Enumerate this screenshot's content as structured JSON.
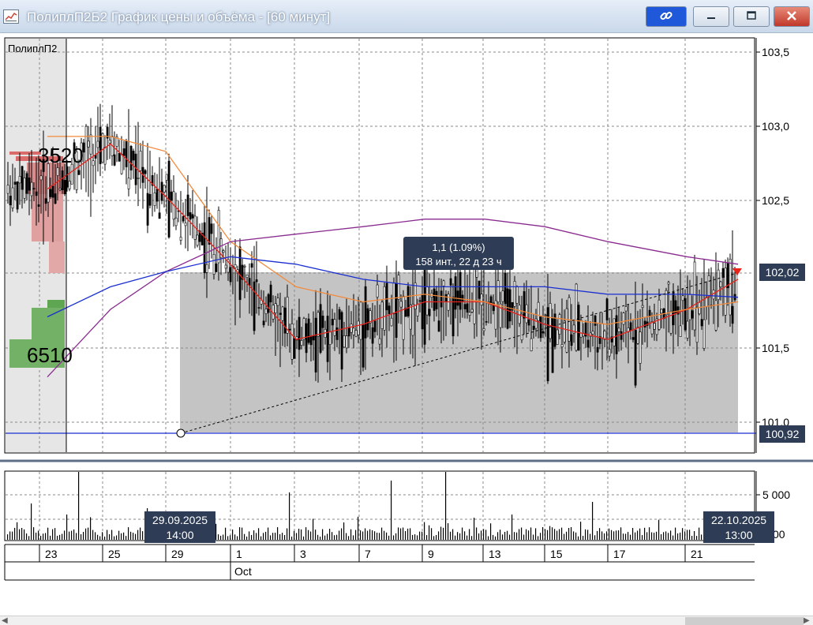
{
  "window": {
    "title": "ПолиплП2Б2 График цены и объёма - [60 минут]"
  },
  "titlebar_buttons": {
    "link_icon": "link-icon",
    "minimize_icon": "minimize-icon",
    "maximize_icon": "maximize-icon",
    "close_icon": "close-icon"
  },
  "chart": {
    "ticker_label": "ПолиплП2",
    "price_axis_ticks": [
      "103,5",
      "103,0",
      "102,5",
      "101,5",
      "101,0"
    ],
    "current_price_tag": "102,02",
    "line_price_tag": "100,92",
    "profile_label_top": "3520",
    "profile_label_bottom": "6510",
    "measure_tooltip_line1": "1,1 (1.09%)",
    "measure_tooltip_line2": "158 инт., 22 д 23 ч",
    "volume_axis_tick": "5 000",
    "volume_axis_tick_cut": "00",
    "cursor_left_date": "29.09.2025",
    "cursor_left_time": "14:00",
    "cursor_right_date": "22.10.2025",
    "cursor_right_time": "13:00",
    "date_ticks": [
      "23",
      "25",
      "29",
      "1",
      "3",
      "7",
      "9",
      "13",
      "15",
      "17",
      "21"
    ],
    "month_label": "Oct",
    "colors": {
      "price_bars": "#000000",
      "ma_fast": "#e8231c",
      "ma_mid": "#f28a3c",
      "ma_slow": "#8a2b8f",
      "ma_blue": "#1b2fd1",
      "selection_fill": "#c4c4c4",
      "tag_bg": "#2e3d55",
      "profile_sell": "#d96b6b",
      "profile_buy": "#5fa653"
    }
  },
  "chart_data": {
    "type": "line",
    "title": "",
    "xlabel": "",
    "ylabel": "",
    "ylim": [
      100.85,
      103.6
    ],
    "x": [
      "23",
      "25",
      "29",
      "1",
      "3",
      "7",
      "9",
      "13",
      "15",
      "17",
      "21",
      "22"
    ],
    "series": [
      {
        "values": [
          102.6,
          102.9,
          102.55,
          102.1,
          101.6,
          101.7,
          101.85,
          101.85,
          101.7,
          101.6,
          101.8,
          102.0
        ]
      },
      {
        "values": [
          102.95,
          102.95,
          102.85,
          102.25,
          101.95,
          101.85,
          101.9,
          101.85,
          101.75,
          101.7,
          101.8,
          101.85
        ]
      },
      {
        "values": [
          101.35,
          101.8,
          102.05,
          102.25,
          102.3,
          102.35,
          102.4,
          102.4,
          102.35,
          102.25,
          102.15,
          102.1
        ]
      },
      {
        "values": [
          101.75,
          101.95,
          102.05,
          102.15,
          102.1,
          102.0,
          101.95,
          101.95,
          101.95,
          101.9,
          101.9,
          101.88
        ]
      }
    ]
  }
}
